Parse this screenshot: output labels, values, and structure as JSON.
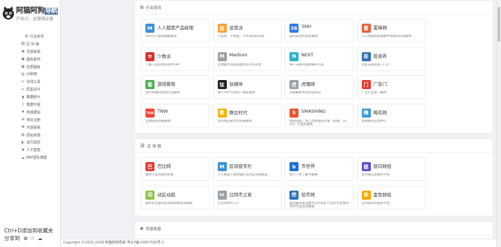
{
  "logo": {
    "title": "阿猫阿狗",
    "title_highlight": "导航",
    "subtitle": "产品汪、运营喵必备"
  },
  "sidebar": {
    "items": [
      {
        "label": "行业资讯",
        "icon": "newspaper-icon"
      },
      {
        "label": "区 块 链",
        "icon": "link-icon"
      },
      {
        "label": "灵感来源",
        "icon": "eye-icon"
      },
      {
        "label": "图库素材",
        "icon": "image-icon"
      },
      {
        "label": "优质图库",
        "icon": "picture-icon"
      },
      {
        "label": "UI常用",
        "icon": "layout-icon"
      },
      {
        "label": "在线工具",
        "icon": "tools-icon"
      },
      {
        "label": "原型设计",
        "icon": "pencil-icon"
      },
      {
        "label": "数据统计",
        "icon": "chart-icon"
      },
      {
        "label": "数据可视",
        "icon": "bar-chart-icon"
      },
      {
        "label": "商城建站",
        "icon": "cart-icon"
      },
      {
        "label": "地址注册",
        "icon": "globe-icon"
      },
      {
        "label": "开源系统",
        "icon": "code-icon"
      },
      {
        "label": "原始资源",
        "icon": "folder-icon"
      },
      {
        "label": "运行监控",
        "icon": "monitor-icon"
      },
      {
        "label": "人工智能",
        "icon": "ai-icon"
      },
      {
        "label": "BAT团队博客",
        "icon": "blog-icon"
      }
    ],
    "footer_line1": "Ctrl+D添加到收藏夹",
    "footer_line2": "分享到",
    "share_icons": [
      "weibo-icon",
      "star-icon",
      "wechat-icon"
    ]
  },
  "sections": [
    {
      "title": "行业资讯",
      "icon": "newspaper-icon",
      "cards": [
        {
          "name": "人人都是产品经理",
          "desc": "300万产品经理聚集地",
          "icon": "renren-icon",
          "color": "#3b8fd9",
          "glyph": "M"
        },
        {
          "name": "运营派",
          "desc": "学运营，学增值，学文案的好去处",
          "icon": "yunyingpai-icon",
          "color": "#f2a23a",
          "glyph": "运"
        },
        {
          "name": "36Kr",
          "desc": "国内知名的创业媒体",
          "icon": "36kr-icon",
          "color": "#2f7ae5",
          "glyph": "36"
        },
        {
          "name": "雷锋网",
          "desc": "人工智能和智能硬件领域的科技媒体",
          "icon": "leifeng-icon",
          "color": "#e6603a",
          "glyph": "雷"
        },
        {
          "name": "少数派",
          "desc": "了解一些好用的软件APP",
          "icon": "sspai-icon",
          "color": "#d9302f",
          "glyph": "π"
        },
        {
          "name": "Medium",
          "desc": "全球最大的高质量创作写作平台",
          "icon": "medium-icon",
          "color": "#9aa0a6",
          "glyph": "M"
        },
        {
          "name": "NEXT",
          "desc": "每一天都可能新鲜的产品",
          "icon": "next-icon",
          "color": "#2bb5c8",
          "glyph": "N"
        },
        {
          "name": "投资界",
          "desc": "创业与投资第一门户",
          "icon": "touzijie-icon",
          "color": "#2e6fb5",
          "glyph": "投"
        },
        {
          "name": "游戏葡萄",
          "desc": "有料有趣的游戏行业媒体",
          "icon": "youxiputao-icon",
          "color": "#4caf50",
          "glyph": "葡"
        },
        {
          "name": "钛媒体",
          "desc": "源于TMT行业的一家新媒体",
          "icon": "taimeiti-icon",
          "color": "#222222",
          "glyph": "钛"
        },
        {
          "name": "虎嗅网",
          "desc": "深度解析商业科技资讯",
          "icon": "huxiu-icon",
          "color": "#9aa0a6",
          "glyph": "虎"
        },
        {
          "name": "广告门",
          "desc": "广告行业第一媒体",
          "icon": "guanggaomen-icon",
          "color": "#e53935",
          "glyph": "门"
        },
        {
          "name": "TNW",
          "desc": "全球知名科技媒体",
          "icon": "tnw-icon",
          "color": "#f4433b",
          "glyph": "TNW"
        },
        {
          "name": "数位时代",
          "desc": "台湾地区最大的科技媒体",
          "icon": "shuweishidai-icon",
          "color": "#f2b400",
          "glyph": "数"
        },
        {
          "name": "SMASHING",
          "desc": "喂饭扣扣，专门为界面设计者（前端，UI，UX）打造的期刊",
          "icon": "smashing-icon",
          "color": "#e8552f",
          "glyph": "S"
        },
        {
          "name": "梅花网",
          "desc": "营销者的信息中心",
          "icon": "meihua-icon",
          "color": "#3a9ad9",
          "glyph": "梅"
        }
      ]
    },
    {
      "title": "区 块 链",
      "icon": "link-icon",
      "cards": [
        {
          "name": "巴比特",
          "desc": "服务于区块链创新者",
          "icon": "babite-icon",
          "color": "#e53935",
          "glyph": "巴"
        },
        {
          "name": "区块链专栏",
          "desc": "人人都是产品经理打造的区块链频道",
          "icon": "qukuailian-icon",
          "color": "#3b8fd9",
          "glyph": "M"
        },
        {
          "name": "币世界",
          "desc": "快人一步了解币圈事",
          "icon": "bishijie-icon",
          "color": "#1e6fd9",
          "glyph": "b"
        },
        {
          "name": "链向财经",
          "desc": "区块链信息服务平台",
          "icon": "lianxiang-icon",
          "color": "#5a4fd1",
          "glyph": "链"
        },
        {
          "name": "动区动趋",
          "desc": "最好的全面的区块链新闻资讯网站",
          "icon": "dongqu-icon",
          "color": "#8bc34a",
          "glyph": "动"
        },
        {
          "name": "比特币之家",
          "desc": "打造比特币门户",
          "icon": "btc-home-icon",
          "color": "#9aa0a6",
          "glyph": "⋈"
        },
        {
          "name": "挖币网",
          "desc": "国内最早关注数字货币挖矿行业的专业数字货币行业资讯网站",
          "icon": "wabi-icon",
          "color": "#2e6fb5",
          "glyph": "挖"
        },
        {
          "name": "金色财经",
          "desc": "区块链资讯服务平台",
          "icon": "jinse-icon",
          "color": "#f2a900",
          "glyph": "金"
        }
      ]
    },
    {
      "title": "灵感来源",
      "icon": "eye-icon",
      "cards": []
    }
  ],
  "footer": {
    "text": "Copyright ©2015-2018 阿猫阿狗导航 粤ICP备14057330号-1"
  }
}
